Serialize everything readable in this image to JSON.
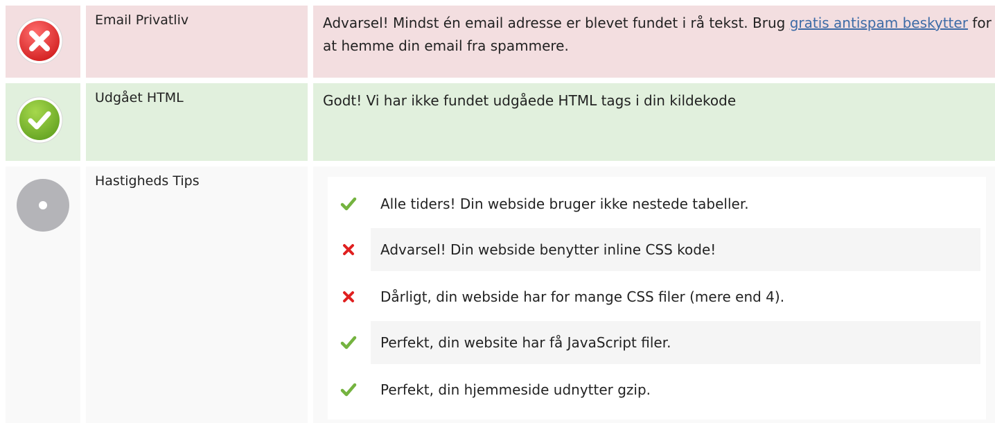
{
  "rows": {
    "email": {
      "status": "error",
      "label": "Email Privatliv",
      "text_before": "Advarsel! Mindst én email adresse er blevet fundet i rå tekst. Brug",
      "link_text": "gratis antispam beskytter",
      "text_after": "for at hemme din email fra spammere."
    },
    "deprecated_html": {
      "status": "ok",
      "label": "Udgået HTML",
      "text": "Godt! Vi har ikke fundet udgåede HTML tags i din kildekode"
    },
    "speed": {
      "status": "neutral",
      "label": "Hastigheds Tips",
      "tips": [
        {
          "icon": "check-icon",
          "text": "Alle tiders! Din webside bruger ikke nestede tabeller."
        },
        {
          "icon": "cross-icon",
          "text": "Advarsel! Din webside benytter inline CSS kode!"
        },
        {
          "icon": "cross-icon",
          "text": "Dårligt, din webside har for mange CSS filer (mere end 4)."
        },
        {
          "icon": "check-icon",
          "text": "Perfekt, din website har få JavaScript filer."
        },
        {
          "icon": "check-icon",
          "text": "Perfekt, din hjemmeside udnytter gzip."
        }
      ]
    }
  },
  "colors": {
    "error_row": "#f3dee0",
    "ok_row": "#e1f0dd",
    "neutral_row": "#f9f9f9",
    "link": "#3d6ba6",
    "check": "#74b33f",
    "cross": "#e02020"
  }
}
